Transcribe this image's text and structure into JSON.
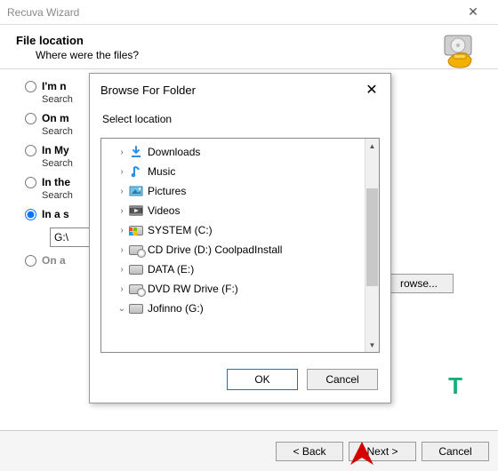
{
  "window": {
    "title": "Recuva Wizard"
  },
  "header": {
    "title": "File location",
    "subtitle": "Where were the files?"
  },
  "options": {
    "o1_title": "I'm n",
    "o1_desc": "Search",
    "o2_title": "On m",
    "o2_desc": "Search",
    "o3_title": "In My",
    "o3_desc": "Search",
    "o4_title": "In the",
    "o4_desc": "Search",
    "o5_title": "In a s",
    "o6_title": "On a",
    "path_value": "G:\\",
    "browse_label": "rowse..."
  },
  "buttons": {
    "back": "< Back",
    "next": "Next >",
    "cancel": "Cancel"
  },
  "modal": {
    "title": "Browse For Folder",
    "subtitle": "Select location",
    "ok": "OK",
    "cancel": "Cancel",
    "nodes": [
      {
        "expand": ">",
        "icon": "download",
        "label": "Downloads"
      },
      {
        "expand": ">",
        "icon": "music",
        "label": "Music"
      },
      {
        "expand": ">",
        "icon": "pictures",
        "label": "Pictures"
      },
      {
        "expand": ">",
        "icon": "videos",
        "label": "Videos"
      },
      {
        "expand": ">",
        "icon": "drive-win",
        "label": "SYSTEM (C:)"
      },
      {
        "expand": ">",
        "icon": "drive-cd",
        "label": "CD Drive (D:) CoolpadInstall"
      },
      {
        "expand": ">",
        "icon": "drive",
        "label": "DATA (E:)"
      },
      {
        "expand": ">",
        "icon": "drive-cd",
        "label": "DVD RW Drive (F:)"
      },
      {
        "expand": "v",
        "icon": "drive",
        "label": "Jofinno (G:)"
      }
    ]
  },
  "watermark": "T"
}
